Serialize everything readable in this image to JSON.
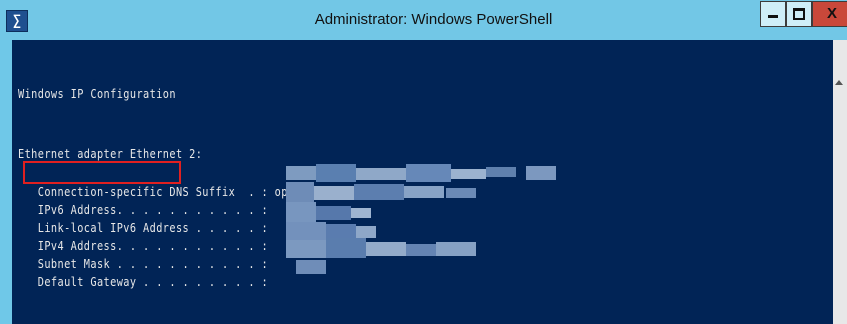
{
  "window": {
    "title": "Administrator: Windows PowerShell",
    "icon": "powershell-icon",
    "controls": {
      "minimize": "minimize-icon",
      "maximize": "maximize-icon",
      "close_label": "X"
    }
  },
  "console": {
    "lines": [
      "Windows IP Configuration",
      "Ethernet adapter Ethernet 2:",
      "   Connection-specific DNS Suffix  . : openstacklocal",
      "   IPv6 Address. . . . . . . . . . . :",
      "   Link-local IPv6 Address . . . . . :",
      "   IPv4 Address. . . . . . . . . . . :",
      "   Subnet Mask . . . . . . . . . . . :",
      "   Default Gateway . . . . . . . . . :"
    ],
    "highlighted_label": "IPv6 Address"
  },
  "colors": {
    "console_bg": "#012456",
    "titlebar_bg": "#72c7e6",
    "highlight": "#e02020"
  }
}
